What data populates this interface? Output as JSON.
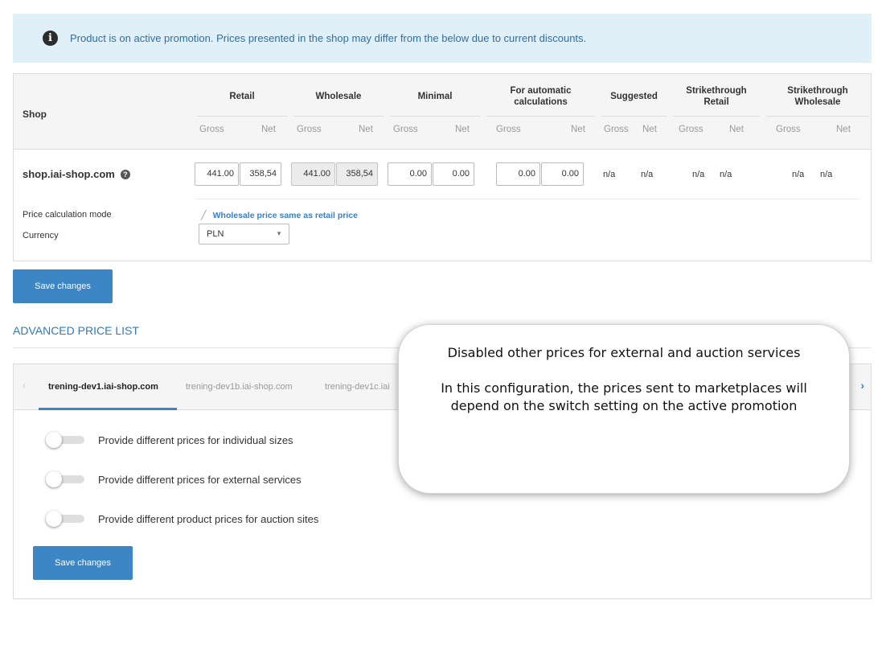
{
  "alert": {
    "text": "Product is on active promotion. Prices presented in the shop may differ from the below due to current discounts."
  },
  "price_table": {
    "shop_header": "Shop",
    "groups": [
      "Retail",
      "Wholesale",
      "Minimal",
      "For automatic calculations",
      "Suggested",
      "Strikethrough Retail",
      "Strikethrough Wholesale"
    ],
    "gross_label": "Gross",
    "net_label": "Net",
    "row": {
      "shop": "shop.iai-shop.com",
      "retail_gross": "441.00",
      "retail_net": "358,54",
      "wholesale_gross": "441.00",
      "wholesale_net": "358,54",
      "minimal_gross": "0.00",
      "minimal_net": "0.00",
      "auto_gross": "0.00",
      "auto_net": "0.00",
      "na": "n/a"
    },
    "price_mode_label": "Price calculation mode",
    "price_mode_value": "Wholesale price same as retail price",
    "currency_label": "Currency",
    "currency_value": "PLN"
  },
  "save_label": "Save changes",
  "advanced": {
    "title": "ADVANCED PRICE LIST",
    "tabs": [
      "trening-dev1.iai-shop.com",
      "trening-dev1b.iai-shop.com",
      "trening-dev1c.iai"
    ],
    "toggles": [
      {
        "label": "Provide different prices for individual sizes",
        "on": false
      },
      {
        "label": "Provide different prices for external services",
        "on": false
      },
      {
        "label": "Provide different product prices for auction sites",
        "on": false
      }
    ]
  },
  "callout": {
    "title": "Disabled other prices for external and auction services",
    "body": "In this configuration, the prices sent to marketplaces will depend on the switch setting on the active promotion"
  },
  "colors": {
    "accent": "#3d86c6",
    "alert_bg": "#dff0f8",
    "link": "#3a7fc1"
  },
  "icons": [
    "info-icon",
    "question-icon",
    "pencil-icon",
    "chevron-down-icon",
    "chevron-left-icon",
    "chevron-right-icon"
  ]
}
